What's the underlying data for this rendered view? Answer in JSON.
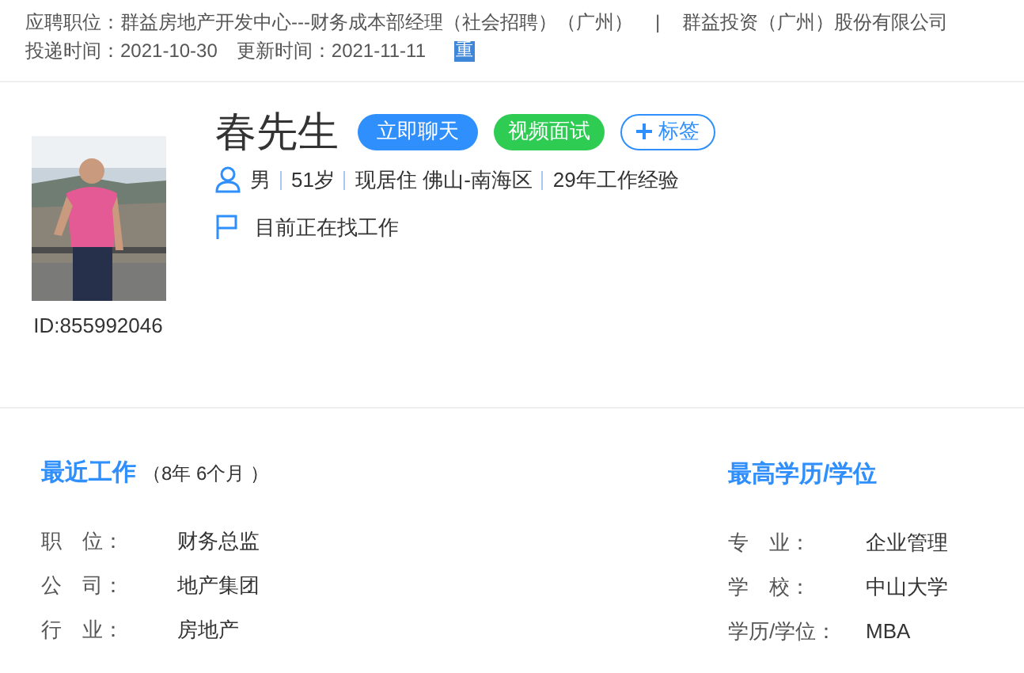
{
  "header": {
    "position_label": "应聘职位：",
    "position": "群益房地产开发中心---财务成本部经理（社会招聘）（广州）",
    "separator": "|",
    "company": "群益投资（广州）股份有限公司",
    "applied_label": "投递时间：",
    "applied": "2021-10-30",
    "updated_label": "更新时间：",
    "updated": "2021-11-11",
    "badge": "重"
  },
  "profile": {
    "id": "ID:855992046",
    "name": "春先生",
    "buttons": [
      {
        "label": "立即聊天",
        "kind": "chat"
      },
      {
        "label": "视频面试",
        "kind": "video"
      },
      {
        "label": "标签",
        "kind": "tag"
      }
    ],
    "facts": [
      "男",
      "51岁",
      "现居住 佛山-南海区",
      "29年工作经验"
    ],
    "status": "目前正在找工作"
  },
  "recent_work": {
    "title": "最近工作",
    "duration": "（8年 6个月 ）",
    "rows": [
      {
        "label": "职　位：",
        "value": "财务总监"
      },
      {
        "label": "公　司：",
        "value": "地产集团"
      },
      {
        "label": "行　业：",
        "value": "房地产"
      }
    ]
  },
  "education": {
    "title": "最高学历/学位",
    "rows": [
      {
        "label": "专　业：",
        "value": "企业管理"
      },
      {
        "label": "学　校：",
        "value": "中山大学"
      },
      {
        "label": "学历/学位：",
        "value": "MBA"
      }
    ]
  }
}
